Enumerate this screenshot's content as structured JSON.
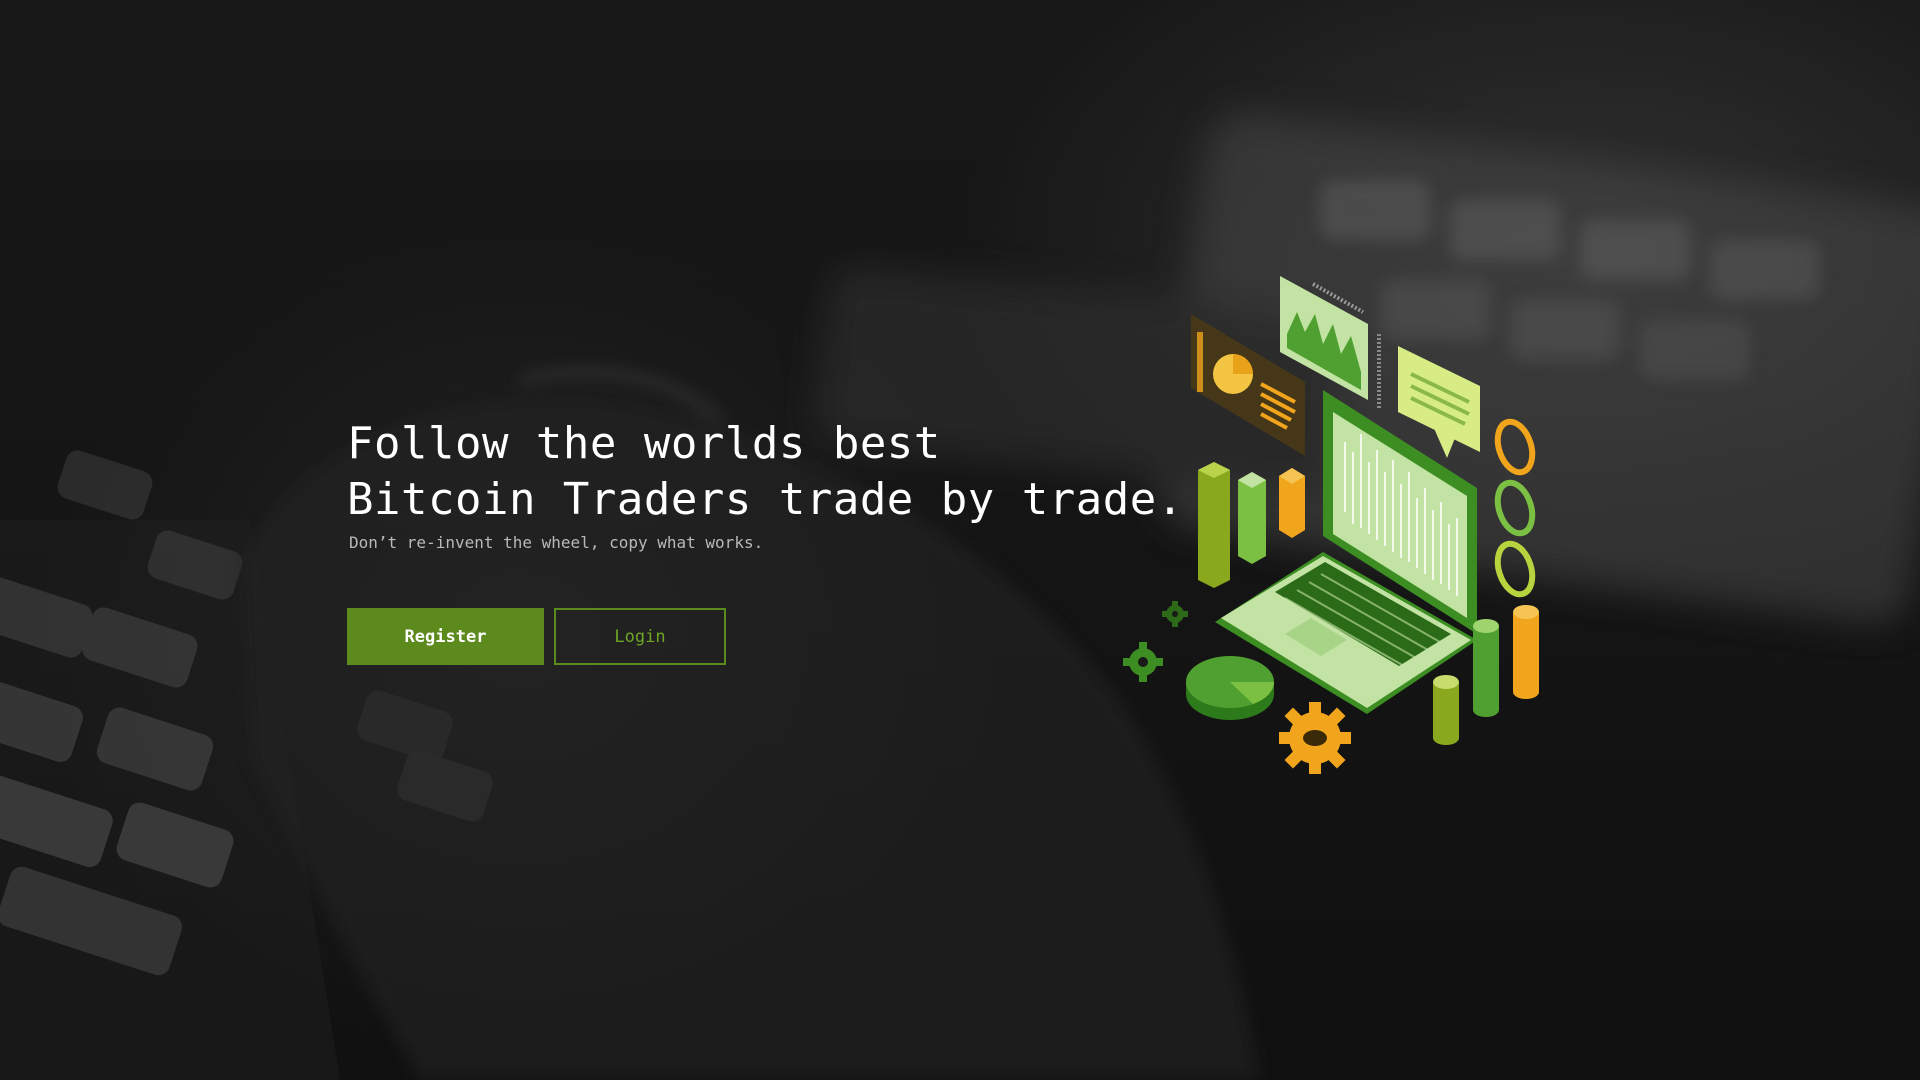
{
  "hero": {
    "title_line1": "Follow the worlds best",
    "title_line2": "Bitcoin Traders trade by trade.",
    "subtitle": "Don’t re-invent the wheel, copy what works."
  },
  "actions": {
    "register_label": "Register",
    "login_label": "Login"
  },
  "colors": {
    "accent": "#5c8a1d",
    "accent_light": "#6ea523",
    "orange": "#f0a51c",
    "light_green": "#c3e3a5",
    "background": "#161616"
  },
  "illustration": {
    "icon": "isometric-laptop-trading-icon"
  }
}
